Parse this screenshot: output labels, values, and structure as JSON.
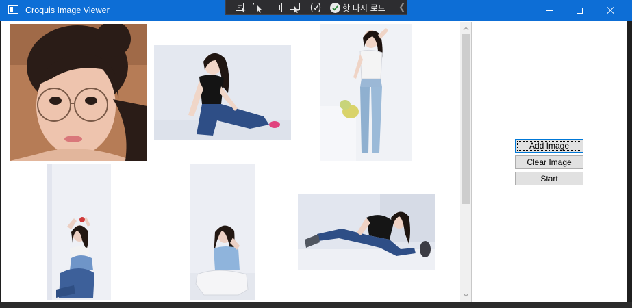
{
  "window": {
    "title": "Croquis Image Viewer",
    "accent": "#0d6ed6"
  },
  "debug_toolbar": {
    "hot_reload_label": "핫 다시 로드",
    "tools": [
      "select-element-icon",
      "pointer-select-icon",
      "display-layout-icon",
      "track-focus-icon",
      "binding-failures-icon"
    ]
  },
  "gallery": {
    "images": [
      {
        "name": "portrait-closeup-glasses",
        "bg": "#b67c56",
        "skin": "#eec4ae",
        "hair": "#2a1c17",
        "top": "#e8c2a8"
      },
      {
        "name": "seated-black-top-jeans",
        "bg": "#e4e8f0",
        "skin": "#f0d6c8",
        "hair": "#201612",
        "top": "#141414"
      },
      {
        "name": "standing-white-top-jeans",
        "bg": "#f0f2f6",
        "skin": "#efd4c6",
        "hair": "#1e1410",
        "top": "#f4f4f4"
      },
      {
        "name": "crouching-denim",
        "bg": "#eef0f5",
        "skin": "#eccfc2",
        "hair": "#231812",
        "top": "#6f95c8"
      },
      {
        "name": "seated-blue-top-white-pants",
        "bg": "#eceef4",
        "skin": "#ecd0c4",
        "hair": "#231813",
        "top": "#8fb4dc"
      },
      {
        "name": "lying-floor-black-top",
        "bg": "#e2e6ef",
        "skin": "#efd2c4",
        "hair": "#1d1410",
        "top": "#151515"
      }
    ]
  },
  "buttons": {
    "add": "Add Image",
    "clear": "Clear Image",
    "start": "Start"
  }
}
